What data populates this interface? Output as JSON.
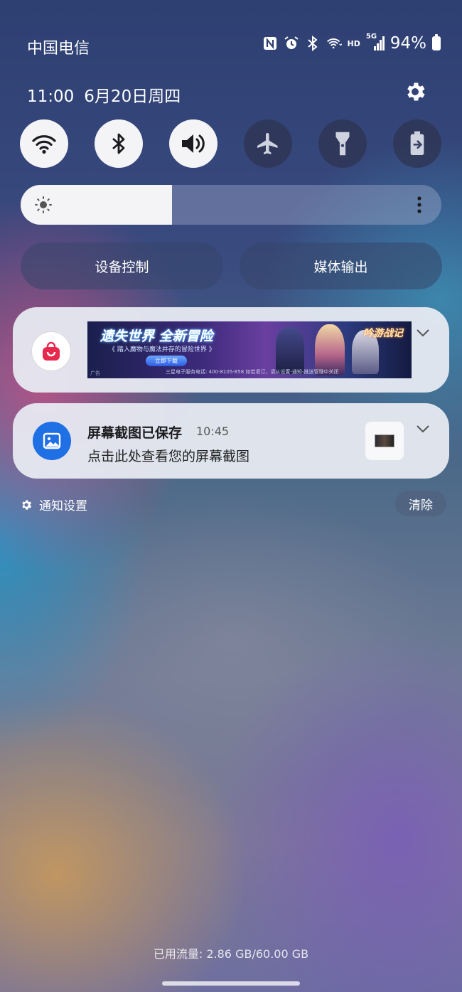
{
  "status_bar": {
    "carrier": "中国电信",
    "battery_percent": "94%",
    "hd_label": "HD",
    "network_label": "5G",
    "icons": [
      "nfc-icon",
      "alarm-icon",
      "bluetooth-icon",
      "wifi-call-icon",
      "signal-icon",
      "battery-icon"
    ]
  },
  "header": {
    "time": "11:00",
    "date": "6月20日周四"
  },
  "quick_settings": {
    "toggles": [
      {
        "name": "wifi",
        "icon": "wifi-icon",
        "on": true
      },
      {
        "name": "bluetooth",
        "icon": "bluetooth-icon",
        "on": true
      },
      {
        "name": "sound",
        "icon": "volume-icon",
        "on": true
      },
      {
        "name": "airplane",
        "icon": "airplane-icon",
        "on": false
      },
      {
        "name": "flashlight",
        "icon": "flashlight-icon",
        "on": false
      },
      {
        "name": "power-saving",
        "icon": "battery-saver-icon",
        "on": false
      }
    ],
    "brightness_level": 0.36,
    "device_control_label": "设备控制",
    "media_output_label": "媒体输出"
  },
  "notifications": {
    "ad": {
      "app_icon": "shopping-bag-icon",
      "banner_title": "遗失世界 全新冒险",
      "banner_subtitle": "《 踏入魔物与魔法并存的冒险世界 》",
      "banner_cta": "立即下载",
      "banner_logo": "吟游战记",
      "ad_label": "广告",
      "footer": "三星电子服务电话: 400-8105-858 如若退订，请从设置-通知-推送管理中关闭"
    },
    "screenshot": {
      "app_icon": "image-icon",
      "title": "屏幕截图已保存",
      "time": "10:45",
      "body": "点击此处查看您的屏幕截图"
    },
    "settings_label": "通知设置",
    "clear_label": "清除"
  },
  "footer": {
    "data_usage": "已用流量: 2.86 GB/60.00 GB"
  },
  "colors": {
    "accent_blue": "#1f6fe5",
    "shop_red": "#e8294e",
    "toggle_on": "#f4f4f6"
  }
}
